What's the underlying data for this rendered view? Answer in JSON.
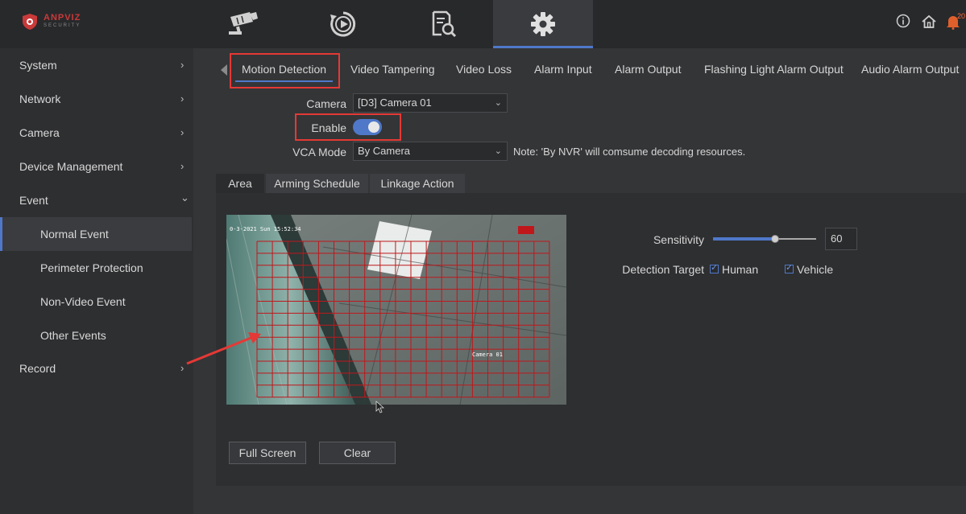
{
  "brand": {
    "name": "ANPVIZ",
    "tagline": "SECURITY"
  },
  "top_nav": [
    {
      "id": "live",
      "icon": "cctv-camera-icon"
    },
    {
      "id": "playback",
      "icon": "playback-icon"
    },
    {
      "id": "search",
      "icon": "file-search-icon"
    },
    {
      "id": "settings",
      "icon": "gear-icon",
      "active": true
    }
  ],
  "top_right": {
    "info_icon": "info-icon",
    "home_icon": "home-icon",
    "bell_icon": "bell-icon",
    "notification_count": "20"
  },
  "sidebar": {
    "items": [
      {
        "label": "System",
        "chevron": "›"
      },
      {
        "label": "Network",
        "chevron": "›"
      },
      {
        "label": "Camera",
        "chevron": "›"
      },
      {
        "label": "Device Management",
        "chevron": "›"
      },
      {
        "label": "Event",
        "chevron": "⌄"
      },
      {
        "label": "Normal Event",
        "active": true
      },
      {
        "label": "Perimeter Protection"
      },
      {
        "label": "Non-Video Event"
      },
      {
        "label": "Other Events"
      },
      {
        "label": "Record",
        "chevron": "›"
      }
    ]
  },
  "tabs": [
    "Motion Detection",
    "Video Tampering",
    "Video Loss",
    "Alarm Input",
    "Alarm Output",
    "Flashing Light Alarm Output",
    "Audio Alarm Output"
  ],
  "form": {
    "camera_label": "Camera",
    "camera_value": "[D3] Camera 01",
    "enable_label": "Enable",
    "enable_on": true,
    "vca_label": "VCA Mode",
    "vca_value": "By Camera",
    "note": "Note: 'By NVR' will comsume decoding resources."
  },
  "subtabs": [
    "Area",
    "Arming Schedule",
    "Linkage Action"
  ],
  "video": {
    "timestamp": "0-3-2021 Sun 15:52:34",
    "camera_name": "Camera 01"
  },
  "buttons": {
    "full_screen": "Full Screen",
    "clear": "Clear"
  },
  "settings": {
    "sensitivity_label": "Sensitivity",
    "sensitivity_value": "60",
    "sensitivity_fraction": 0.6,
    "detection_target_label": "Detection Target",
    "targets": [
      {
        "label": "Human",
        "checked": true
      },
      {
        "label": "Vehicle",
        "checked": true
      }
    ]
  },
  "colors": {
    "accent": "#4f78c9",
    "highlight": "#e53935",
    "grid": "#c0171b"
  }
}
